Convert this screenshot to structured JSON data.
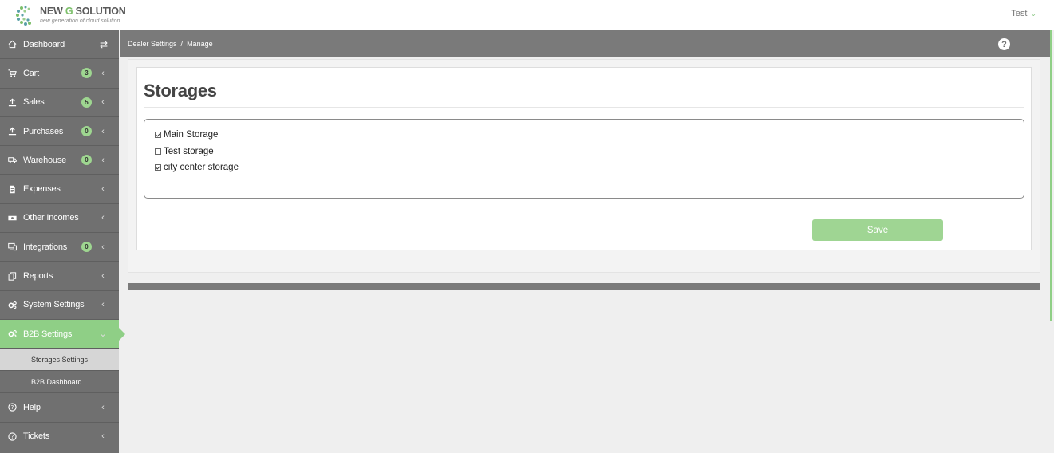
{
  "header": {
    "logo_title_a": "NEW ",
    "logo_title_g": "G",
    "logo_title_b": " SOLUTION",
    "logo_sub": "new generation of cloud solution",
    "user_name": "Test"
  },
  "sidebar": {
    "items": [
      {
        "label": "Dashboard",
        "icon": "home-icon"
      },
      {
        "label": "Cart",
        "icon": "cart-icon",
        "badge": "3"
      },
      {
        "label": "Sales",
        "icon": "upload-icon",
        "badge": "5"
      },
      {
        "label": "Purchases",
        "icon": "upload-icon",
        "badge": "0"
      },
      {
        "label": "Warehouse",
        "icon": "truck-icon",
        "badge": "0"
      },
      {
        "label": "Expenses",
        "icon": "document-icon"
      },
      {
        "label": "Other Incomes",
        "icon": "money-icon"
      },
      {
        "label": "Integrations",
        "icon": "devices-icon",
        "badge": "0"
      },
      {
        "label": "Reports",
        "icon": "copy-icon"
      },
      {
        "label": "System Settings",
        "icon": "gears-icon"
      },
      {
        "label": "B2B Settings",
        "icon": "gears-icon"
      },
      {
        "label": "Help",
        "icon": "question-icon"
      },
      {
        "label": "Tickets",
        "icon": "question-icon"
      }
    ],
    "b2b_sub": [
      "Storages Settings",
      "B2B Dashboard"
    ]
  },
  "breadcrumb": {
    "parent": "Dealer Settings",
    "separator": "/",
    "current": "Manage"
  },
  "help_label": "?",
  "main": {
    "title": "Storages",
    "storages": [
      {
        "label": "Main Storage",
        "checked": true
      },
      {
        "label": "Test storage",
        "checked": false
      },
      {
        "label": "city center storage",
        "checked": true
      }
    ],
    "save_label": "Save"
  },
  "colors": {
    "accent": "#8fcf86",
    "sidebar": "#707070",
    "breadcrumb_bar": "#7a7a7a",
    "save_button": "#9fd593"
  }
}
